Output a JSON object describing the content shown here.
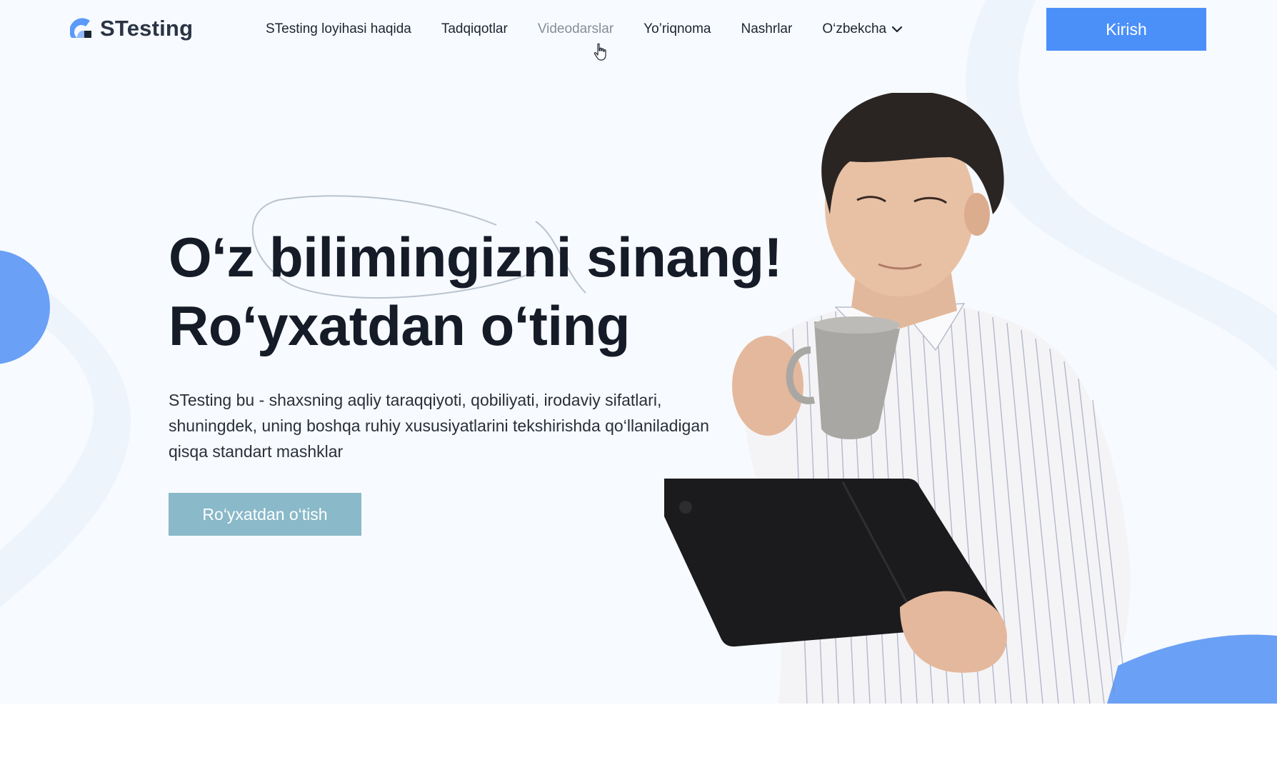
{
  "header": {
    "logo_text": "STesting",
    "nav": [
      {
        "label": "STesting loyihasi haqida"
      },
      {
        "label": "Tadqiqotlar"
      },
      {
        "label": "Videodarslar"
      },
      {
        "label": "Yo’riqnoma"
      },
      {
        "label": "Nashrlar"
      }
    ],
    "language": "O‘zbekcha",
    "login_label": "Kirish"
  },
  "hero": {
    "headline_line1": "O‘z bilimingizni sinang!",
    "headline_line2": "Ro‘yxatdan o‘ting",
    "description": "STesting bu - shaxsning aqliy taraqqiyoti, qobiliyati, irodaviy sifatlari, shuningdek, uning boshqa ruhiy xususiyatlarini tekshirishda qo‘llaniladigan qisqa standart mashklar",
    "register_label": "Ro‘yxatdan o‘tish"
  },
  "colors": {
    "accent": "#4b90f9",
    "register_button": "#8ab9c9",
    "hero_background": "#f7fafe",
    "heading": "#151b27",
    "nav_hover": "#868d97"
  },
  "icons": {
    "logo": "logo-mark-icon",
    "language_dropdown": "chevron-down-icon",
    "cursor": "hand-pointer-icon"
  }
}
